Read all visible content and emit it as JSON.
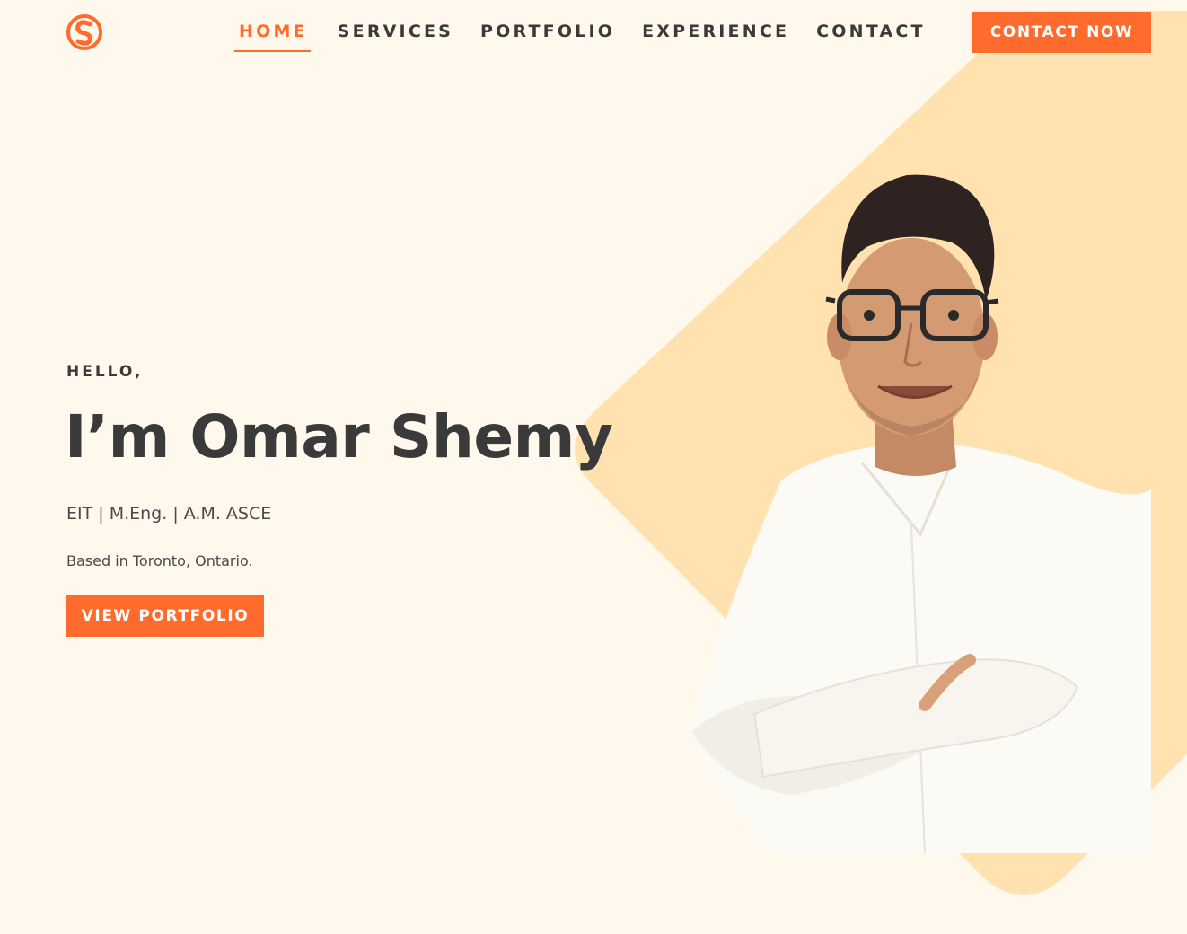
{
  "header": {
    "logo_icon": "s-monogram-logo",
    "nav": [
      {
        "label": "HOME",
        "active": true
      },
      {
        "label": "SERVICES",
        "active": false
      },
      {
        "label": "PORTFOLIO",
        "active": false
      },
      {
        "label": "EXPERIENCE",
        "active": false
      },
      {
        "label": "CONTACT",
        "active": false
      }
    ],
    "cta_label": "CONTACT NOW"
  },
  "hero": {
    "greeting": "HELLO,",
    "title": "I’m Omar Shemy",
    "credentials": "EIT | M.Eng. | A.M. ASCE",
    "location": "Based in Toronto, Ontario.",
    "cta_label": "VIEW PORTFOLIO",
    "portrait_icon": "person-portrait-photo"
  },
  "colors": {
    "accent": "#ff6b2c",
    "background": "#fff8ec",
    "diamond": "#ffe2b0",
    "text": "#3a3a3a"
  }
}
